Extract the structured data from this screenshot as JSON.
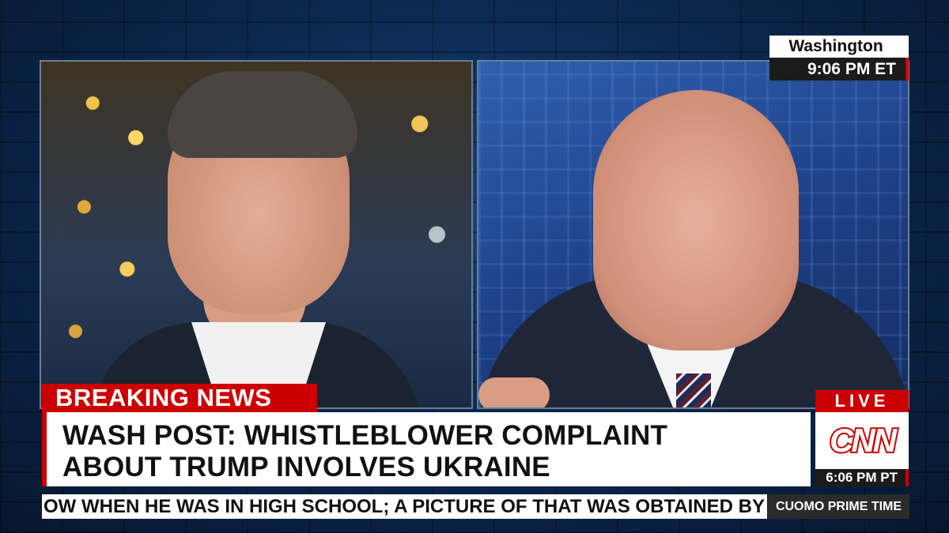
{
  "location": {
    "city": "Washington",
    "time": "9:06 PM ET"
  },
  "banner": {
    "label": "BREAKING NEWS",
    "headline_lines": [
      "WASH POST: WHISTLEBLOWER COMPLAINT",
      "ABOUT TRUMP INVOLVES UKRAINE"
    ]
  },
  "network": {
    "live": "LIVE",
    "logo_text": "CNN",
    "time": "6:06 PM PT"
  },
  "ticker": {
    "text": "OW WHEN HE WAS IN HIGH SCHOOL; A PICTURE OF THAT WAS OBTAINED BY"
  },
  "show": {
    "name": "CUOMO PRIME TIME"
  },
  "colors": {
    "red": "#cc0000",
    "dark": "#1b1b1b",
    "background": "#0a1a33"
  }
}
